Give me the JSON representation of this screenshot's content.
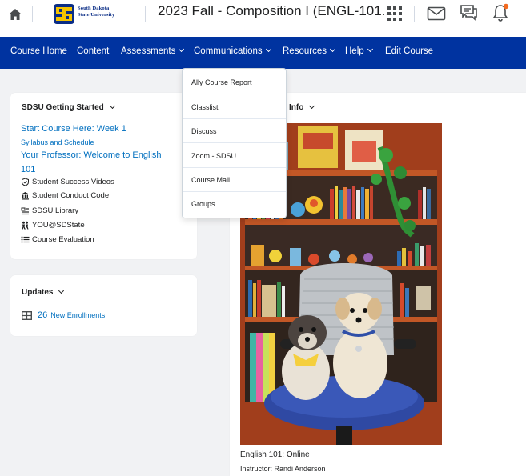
{
  "header": {
    "logo_line1": "South Dakota",
    "logo_line2": "State University",
    "course_title": "2023 Fall - Composition I (ENGL-101..."
  },
  "nav": [
    {
      "label": "Course Home",
      "dropdown": false
    },
    {
      "label": "Content",
      "dropdown": false
    },
    {
      "label": "Assessments",
      "dropdown": true
    },
    {
      "label": "Communications",
      "dropdown": true
    },
    {
      "label": "Resources",
      "dropdown": true
    },
    {
      "label": "Help",
      "dropdown": true
    },
    {
      "label": "Edit Course",
      "dropdown": false
    }
  ],
  "communications_menu": [
    "Ally Course Report",
    "Classlist",
    "Discuss",
    "Zoom - SDSU",
    "Course Mail",
    "Groups"
  ],
  "getting_started": {
    "title": "SDSU Getting Started",
    "link_week1": "Start Course Here: Week 1",
    "link_syllabus": "Syllabus and Schedule",
    "link_professor_line1": "Your Professor: Welcome to English",
    "link_professor_line2": "101",
    "items": [
      {
        "label": "Student Success Videos",
        "icon": "shield-check-icon"
      },
      {
        "label": "Student Conduct Code",
        "icon": "institution-icon"
      },
      {
        "label": "SDSU Library",
        "icon": "library-list-icon"
      },
      {
        "label": "YOU@SDState",
        "icon": "people-icon"
      },
      {
        "label": "Course Evaluation",
        "icon": "bulleted-list-icon"
      }
    ]
  },
  "updates": {
    "title": "Updates",
    "count": "26",
    "label": "New Enrollments"
  },
  "course_info": {
    "title_partial": "Info",
    "caption": "English 101: Online",
    "instructor": "Instructor: Randi Anderson"
  },
  "colors": {
    "nav_bg": "#0033a0",
    "link": "#006fbf",
    "notification_dot": "#f46a1f"
  }
}
